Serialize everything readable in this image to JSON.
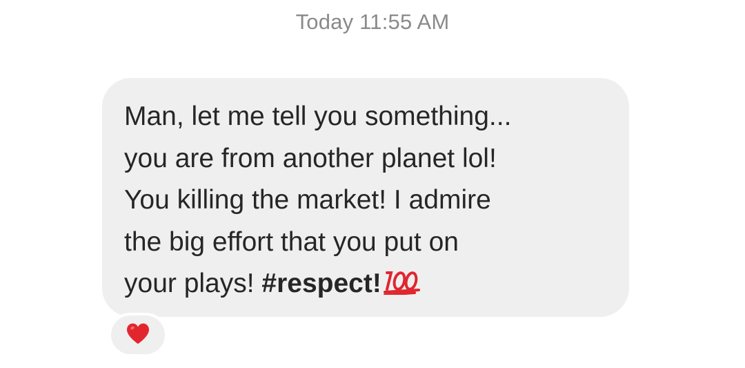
{
  "conversation": {
    "timestamp": "Today 11:55 AM",
    "message": {
      "lines": [
        "Man, let me tell you something...",
        "you are from another planet lol!",
        "You killing the market! I admire",
        "the big effort that you put on",
        "your plays! "
      ],
      "hashtag": "#respect!",
      "trailing_emoji": "hundred-points-icon",
      "bubble_color": "#efefef",
      "text_color": "#262626"
    },
    "reaction": {
      "emoji": "red-heart-icon",
      "color": "#e3262e"
    },
    "timestamp_color": "#8a8a8a"
  }
}
